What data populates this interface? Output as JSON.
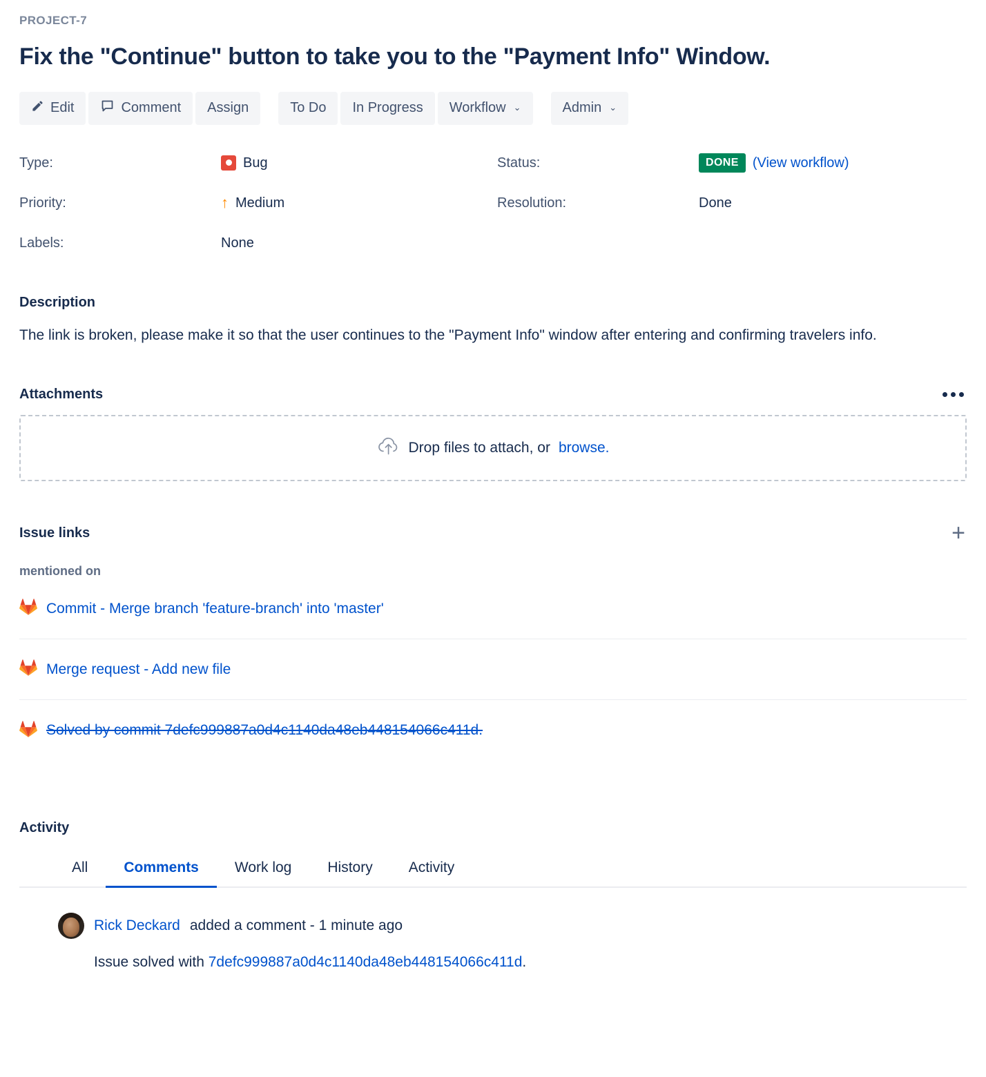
{
  "breadcrumb": "PROJECT-7",
  "title": "Fix the \"Continue\" button to take you to the \"Payment Info\" Window.",
  "toolbar": {
    "edit": "Edit",
    "comment": "Comment",
    "assign": "Assign",
    "todo": "To Do",
    "in_progress": "In Progress",
    "workflow": "Workflow",
    "admin": "Admin",
    "caret": "⌄"
  },
  "fields": {
    "type_label": "Type:",
    "type_value": "Bug",
    "priority_label": "Priority:",
    "priority_value": "Medium",
    "priority_arrow": "↑",
    "labels_label": "Labels:",
    "labels_value": "None",
    "status_label": "Status:",
    "status_value": "DONE",
    "view_workflow": "(View workflow)",
    "resolution_label": "Resolution:",
    "resolution_value": "Done"
  },
  "description": {
    "heading": "Description",
    "body": "The link is broken, please make it so that the user continues to the \"Payment Info\" window after entering and confirming travelers info."
  },
  "attachments": {
    "heading": "Attachments",
    "drop_text": "Drop files to attach, or",
    "browse_text": "browse."
  },
  "issue_links": {
    "heading": "Issue links",
    "add_label": "+",
    "group_label": "mentioned on",
    "items": [
      {
        "text": "Commit - Merge branch 'feature-branch' into 'master'",
        "resolved": false
      },
      {
        "text": "Merge request - Add new file",
        "resolved": false
      },
      {
        "text": "Solved by commit 7defc999887a0d4c1140da48eb448154066c411d.",
        "resolved": true
      }
    ]
  },
  "activity": {
    "heading": "Activity",
    "tabs": [
      {
        "label": "All",
        "active": false
      },
      {
        "label": "Comments",
        "active": true
      },
      {
        "label": "Work log",
        "active": false
      },
      {
        "label": "History",
        "active": false
      },
      {
        "label": "Activity",
        "active": false
      }
    ],
    "comment": {
      "chevron": "⌄",
      "author": "Rick Deckard",
      "meta": " added a comment - 1 minute ago",
      "text_prefix": "Issue solved with ",
      "hash": "7defc999887a0d4c1140da48eb448154066c411d",
      "text_suffix": "."
    }
  },
  "colors": {
    "link": "#0052CC",
    "status_done": "#00875A",
    "bug_red": "#E5493A",
    "priority_orange": "#FF8B00",
    "text": "#172B4D",
    "muted": "#5E6C84"
  }
}
